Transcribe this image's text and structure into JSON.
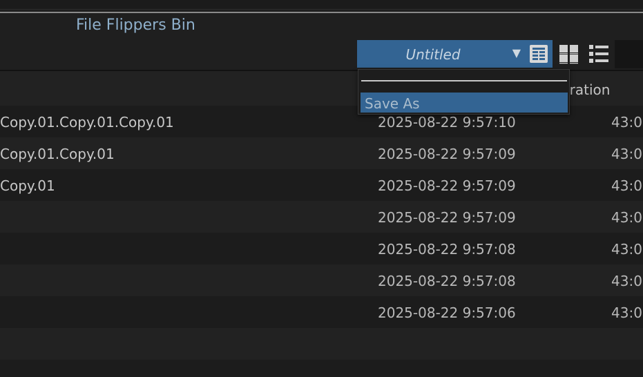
{
  "bin": {
    "title": "File Flippers Bin"
  },
  "toolbar": {
    "view_select_value": "Untitled",
    "view_modes": [
      "table-view-icon",
      "grid-view-icon",
      "list-view-icon"
    ],
    "active_view_mode": "table-view-icon"
  },
  "dropdown": {
    "items": [
      {
        "label": "Save As",
        "highlighted": true
      }
    ]
  },
  "table": {
    "columns": {
      "duration": "uration"
    },
    "rows": [
      {
        "name": "Copy.01.Copy.01.Copy.01",
        "date": "2025-08-22 9:57:10",
        "duration": "43:0"
      },
      {
        "name": "Copy.01.Copy.01",
        "date": "2025-08-22 9:57:09",
        "duration": "43:0"
      },
      {
        "name": "Copy.01",
        "date": "2025-08-22 9:57:09",
        "duration": "43:0"
      },
      {
        "name": "",
        "date": "2025-08-22 9:57:09",
        "duration": "43:0"
      },
      {
        "name": "",
        "date": "2025-08-22 9:57:08",
        "duration": "43:0"
      },
      {
        "name": "",
        "date": "2025-08-22 9:57:08",
        "duration": "43:0"
      },
      {
        "name": "",
        "date": "2025-08-22 9:57:06",
        "duration": "43:0"
      }
    ]
  },
  "colors": {
    "accent": "#336493",
    "title": "#8fb0cc",
    "background": "#1f1f1f"
  }
}
